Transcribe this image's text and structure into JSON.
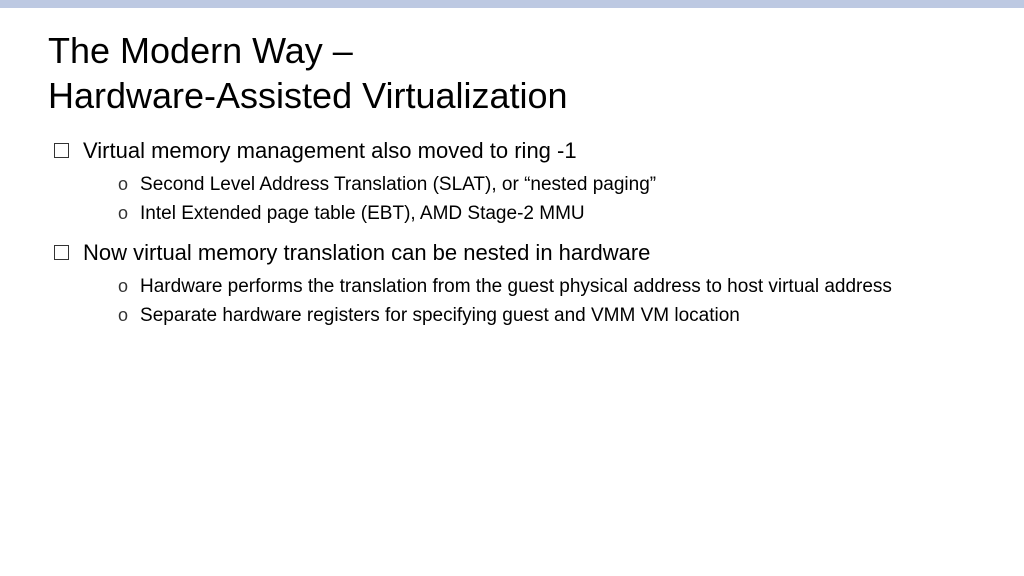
{
  "title_line1": "The Modern Way –",
  "title_line2": "Hardware-Assisted Virtualization",
  "bullets": [
    {
      "text": "Virtual memory management also moved to ring -1",
      "subs": [
        "Second Level Address Translation (SLAT), or “nested paging”",
        "Intel Extended page table (EBT), AMD Stage-2 MMU"
      ]
    },
    {
      "text": "Now virtual memory translation can be nested in hardware",
      "subs": [
        "Hardware performs the translation from the guest physical address to host virtual address",
        "Separate hardware registers for specifying guest and VMM VM location"
      ]
    }
  ]
}
